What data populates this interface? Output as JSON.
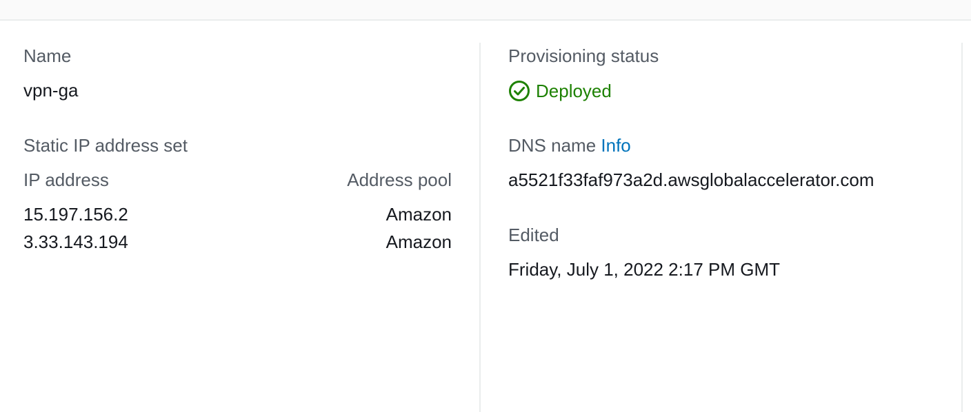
{
  "colors": {
    "label": "#545b64",
    "value": "#16191f",
    "success": "#1d8102",
    "link": "#0073bb",
    "divider": "#eaeded"
  },
  "left": {
    "name_label": "Name",
    "name_value": "vpn-ga",
    "ip_set_label": "Static IP address set",
    "ip_table": {
      "headers": [
        "IP address",
        "Address pool"
      ],
      "rows": [
        [
          "15.197.156.2",
          "Amazon"
        ],
        [
          "3.33.143.194",
          "Amazon"
        ]
      ]
    }
  },
  "right": {
    "provisioning_label": "Provisioning status",
    "provisioning_icon": "check-circle-icon",
    "provisioning_value": "Deployed",
    "dns_label": "DNS name",
    "dns_info_link": "Info",
    "dns_value": "a5521f33faf973a2d.awsglobalaccelerator.com",
    "edited_label": "Edited",
    "edited_value": "Friday, July 1, 2022 2:17 PM GMT"
  }
}
